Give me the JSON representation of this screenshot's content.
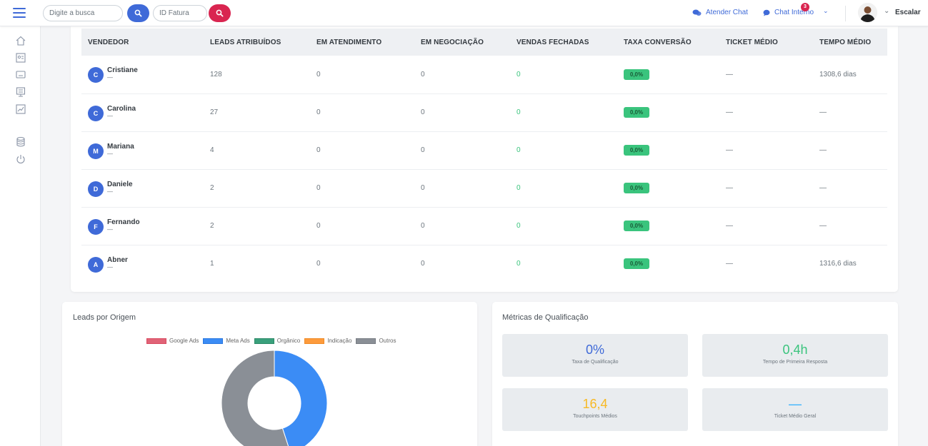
{
  "topbar": {
    "search_placeholder": "Digite a busca",
    "invoice_placeholder": "ID Fatura",
    "atender_chat": "Atender Chat",
    "chat_interno": "Chat Interno",
    "chat_badge": "3",
    "user_name": "Escalar"
  },
  "table": {
    "headers": [
      "VENDEDOR",
      "LEADS ATRIBUÍDOS",
      "EM ATENDIMENTO",
      "EM NEGOCIAÇÃO",
      "VENDAS FECHADAS",
      "TAXA CONVERSÃO",
      "TICKET MÉDIO",
      "TEMPO MÉDIO"
    ],
    "rows": [
      {
        "initial": "C",
        "name": "Cristiane",
        "sub": "—",
        "leads": "128",
        "atendimento": "0",
        "negociacao": "0",
        "vendas": "0",
        "taxa": "0,0%",
        "ticket": "—",
        "tempo": "1308,6 dias"
      },
      {
        "initial": "C",
        "name": "Carolina",
        "sub": "—",
        "leads": "27",
        "atendimento": "0",
        "negociacao": "0",
        "vendas": "0",
        "taxa": "0,0%",
        "ticket": "—",
        "tempo": "—"
      },
      {
        "initial": "M",
        "name": "Mariana",
        "sub": "—",
        "leads": "4",
        "atendimento": "0",
        "negociacao": "0",
        "vendas": "0",
        "taxa": "0,0%",
        "ticket": "—",
        "tempo": "—"
      },
      {
        "initial": "D",
        "name": "Daniele",
        "sub": "—",
        "leads": "2",
        "atendimento": "0",
        "negociacao": "0",
        "vendas": "0",
        "taxa": "0,0%",
        "ticket": "—",
        "tempo": "—"
      },
      {
        "initial": "F",
        "name": "Fernando",
        "sub": "—",
        "leads": "2",
        "atendimento": "0",
        "negociacao": "0",
        "vendas": "0",
        "taxa": "0,0%",
        "ticket": "—",
        "tempo": "—"
      },
      {
        "initial": "A",
        "name": "Abner",
        "sub": "—",
        "leads": "1",
        "atendimento": "0",
        "negociacao": "0",
        "vendas": "0",
        "taxa": "0,0%",
        "ticket": "—",
        "tempo": "1316,6 dias"
      }
    ]
  },
  "origin": {
    "title": "Leads por Origem",
    "legend": [
      {
        "label": "Google Ads",
        "color": "#e06377",
        "border": "#d94a60"
      },
      {
        "label": "Meta Ads",
        "color": "#3b8cf5",
        "border": "#2a78e0"
      },
      {
        "label": "Orgânico",
        "color": "#3aa07c",
        "border": "#2b8a67"
      },
      {
        "label": "Indicação",
        "color": "#fd9b3c",
        "border": "#f08a25"
      },
      {
        "label": "Outros",
        "color": "#8a8f96",
        "border": "#777c83"
      }
    ]
  },
  "chart_data": {
    "type": "pie",
    "title": "Leads por Origem",
    "categories": [
      "Google Ads",
      "Meta Ads",
      "Orgânico",
      "Indicação",
      "Outros"
    ],
    "values": [
      0,
      45,
      0,
      0,
      55
    ],
    "colors": [
      "#e06377",
      "#3b8cf5",
      "#3aa07c",
      "#fd9b3c",
      "#8a8f96"
    ],
    "donut": true,
    "legend_position": "top"
  },
  "metrics": {
    "title": "Métricas de Qualificação",
    "items": [
      {
        "value": "0%",
        "label": "Taxa de Qualificação",
        "color": "#3f6ad8"
      },
      {
        "value": "0,4h",
        "label": "Tempo de Primeira Resposta",
        "color": "#3ac47d"
      },
      {
        "value": "16,4",
        "label": "Touchpoints Médios",
        "color": "#f7b924"
      },
      {
        "value": "—",
        "label": "Ticket Médio Geral",
        "color": "#30b1ff"
      }
    ]
  },
  "colors": {
    "primary": "#3f6ad8",
    "danger": "#d92550",
    "success": "#3ac47d"
  },
  "sidebar": {
    "icons": [
      "home-icon",
      "contacts-icon",
      "chat-icon",
      "presentation-icon",
      "chart-icon",
      "database-icon",
      "power-icon"
    ]
  }
}
